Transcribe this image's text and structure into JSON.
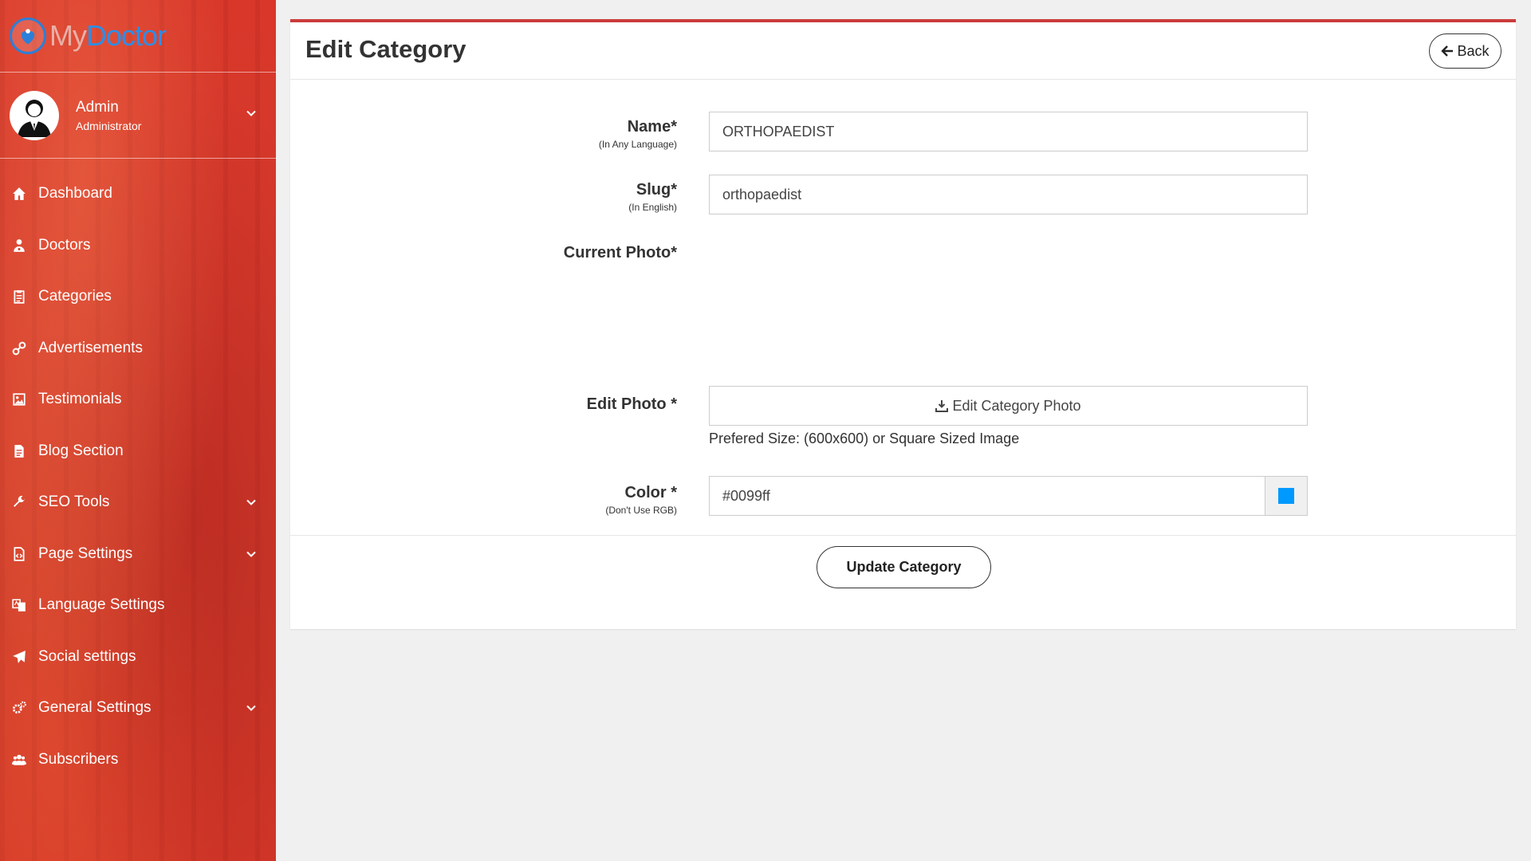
{
  "brand": {
    "my": "My",
    "doctor": "Doctor"
  },
  "user": {
    "name": "Admin",
    "role": "Administrator"
  },
  "sidebar": {
    "items": [
      {
        "label": "Dashboard",
        "icon": "home-icon",
        "expandable": false
      },
      {
        "label": "Doctors",
        "icon": "user-md-icon",
        "expandable": false
      },
      {
        "label": "Categories",
        "icon": "clipboard-icon",
        "expandable": false
      },
      {
        "label": "Advertisements",
        "icon": "link-icon",
        "expandable": false
      },
      {
        "label": "Testimonials",
        "icon": "image-icon",
        "expandable": false
      },
      {
        "label": "Blog Section",
        "icon": "file-icon",
        "expandable": false
      },
      {
        "label": "SEO Tools",
        "icon": "wrench-icon",
        "expandable": true
      },
      {
        "label": "Page Settings",
        "icon": "file-code-icon",
        "expandable": true
      },
      {
        "label": "Language Settings",
        "icon": "language-icon",
        "expandable": false
      },
      {
        "label": "Social settings",
        "icon": "paper-plane-icon",
        "expandable": false
      },
      {
        "label": "General Settings",
        "icon": "cogs-icon",
        "expandable": true
      },
      {
        "label": "Subscribers",
        "icon": "users-icon",
        "expandable": false
      }
    ]
  },
  "header": {
    "title": "Edit Category",
    "back_label": "Back"
  },
  "form": {
    "name": {
      "label": "Name*",
      "sublabel": "(In Any Language)",
      "value": "ORTHOPAEDIST"
    },
    "slug": {
      "label": "Slug*",
      "sublabel": "(In English)",
      "value": "orthopaedist"
    },
    "current_photo": {
      "label": "Current Photo*"
    },
    "edit_photo": {
      "label": "Edit Photo *",
      "button_label": "Edit Category Photo",
      "hint": "Prefered Size: (600x600) or Square Sized Image"
    },
    "color": {
      "label": "Color *",
      "sublabel": "(Don't Use RGB)",
      "value": "#0099ff"
    },
    "submit_label": "Update Category"
  },
  "colors": {
    "accent": "#cc3b3b",
    "swatch": "#0099ff",
    "sidebar": "#d23a2c"
  }
}
